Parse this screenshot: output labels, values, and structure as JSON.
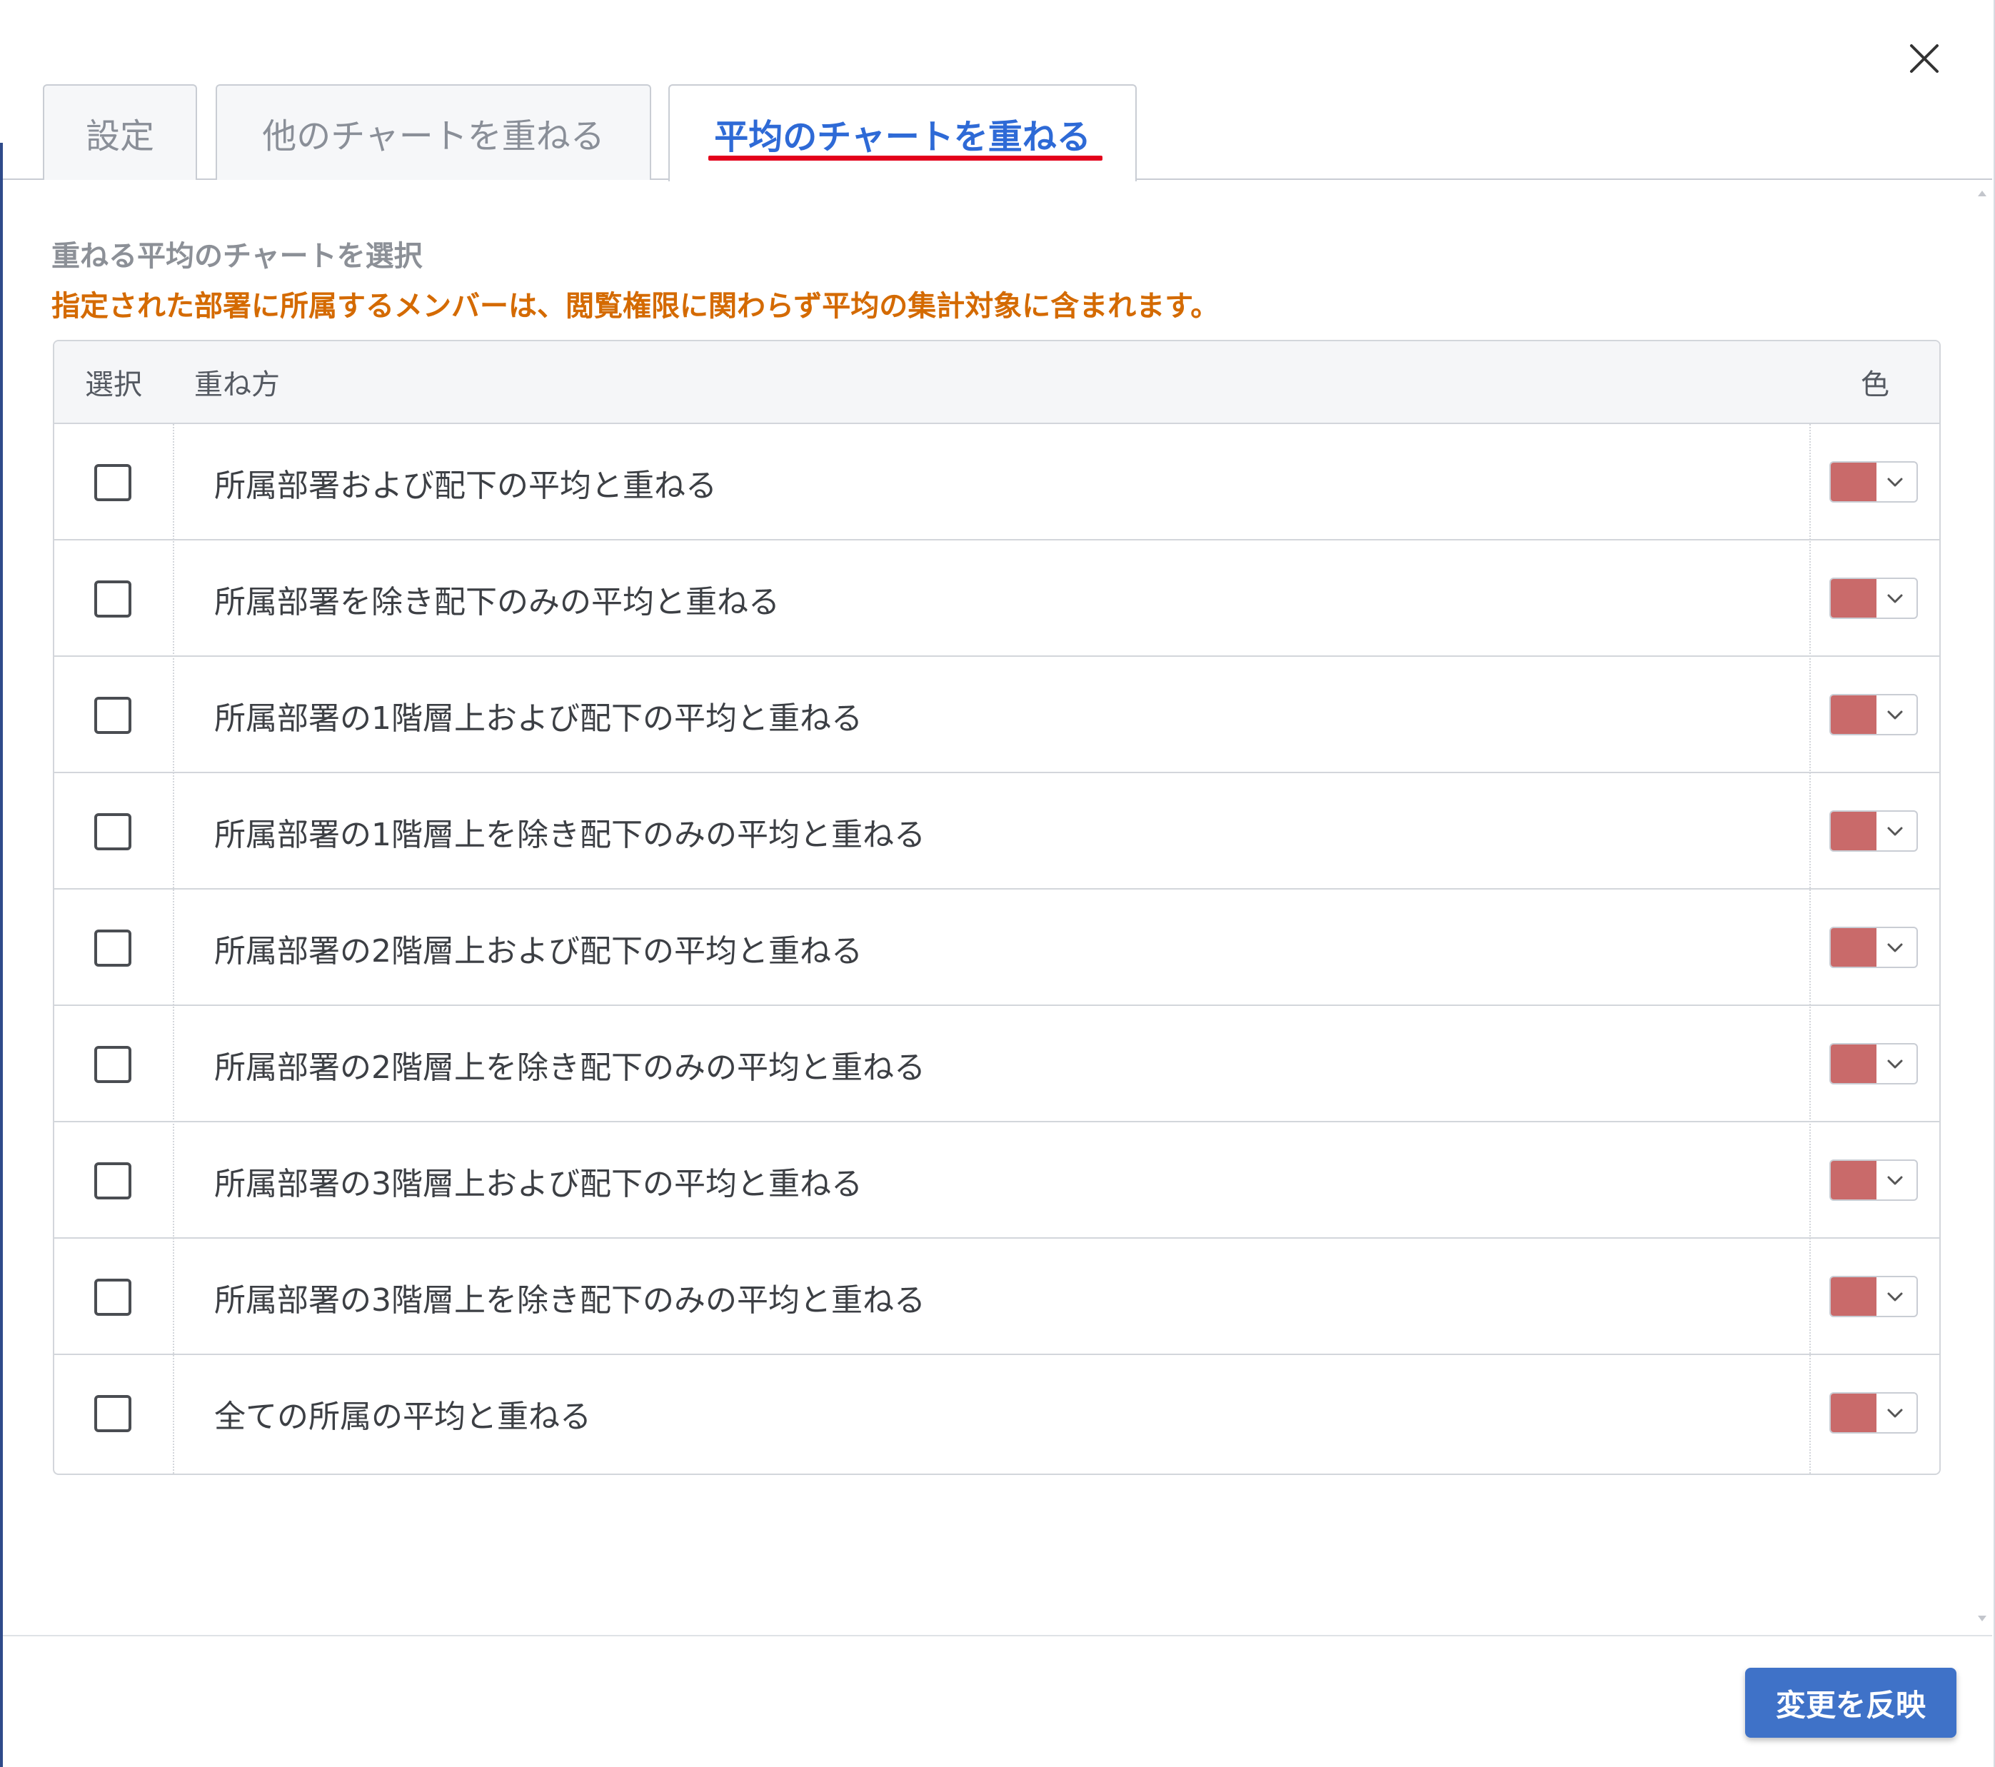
{
  "tabs": [
    {
      "label": "設定",
      "active": false
    },
    {
      "label": "他のチャートを重ねる",
      "active": false
    },
    {
      "label": "平均のチャートを重ねる",
      "active": true
    }
  ],
  "section_label": "重ねる平均のチャートを選択",
  "notice": "指定された部署に所属するメンバーは、閲覧権限に関わらず平均の集計対象に含まれます。",
  "table": {
    "headers": {
      "select": "選択",
      "method": "重ね方",
      "color": "色"
    },
    "rows": [
      {
        "label": "所属部署および配下の平均と重ねる",
        "checked": false,
        "color": "#c96a6a"
      },
      {
        "label": "所属部署を除き配下のみの平均と重ねる",
        "checked": false,
        "color": "#c96a6a"
      },
      {
        "label": "所属部署の1階層上および配下の平均と重ねる",
        "checked": false,
        "color": "#c96a6a"
      },
      {
        "label": "所属部署の1階層上を除き配下のみの平均と重ねる",
        "checked": false,
        "color": "#c96a6a"
      },
      {
        "label": "所属部署の2階層上および配下の平均と重ねる",
        "checked": false,
        "color": "#c96a6a"
      },
      {
        "label": "所属部署の2階層上を除き配下のみの平均と重ねる",
        "checked": false,
        "color": "#c96a6a"
      },
      {
        "label": "所属部署の3階層上および配下の平均と重ねる",
        "checked": false,
        "color": "#c96a6a"
      },
      {
        "label": "所属部署の3階層上を除き配下のみの平均と重ねる",
        "checked": false,
        "color": "#c96a6a"
      },
      {
        "label": "全ての所属の平均と重ねる",
        "checked": false,
        "color": "#c96a6a"
      }
    ]
  },
  "footer": {
    "apply_label": "変更を反映"
  },
  "icons": {
    "close": "close-icon",
    "dropdown": "chevron-down-icon"
  },
  "colors": {
    "accent": "#3f72c8",
    "active_tab_text": "#2e6ad6",
    "tab_underline": "#e3001b",
    "notice": "#d46a00"
  }
}
